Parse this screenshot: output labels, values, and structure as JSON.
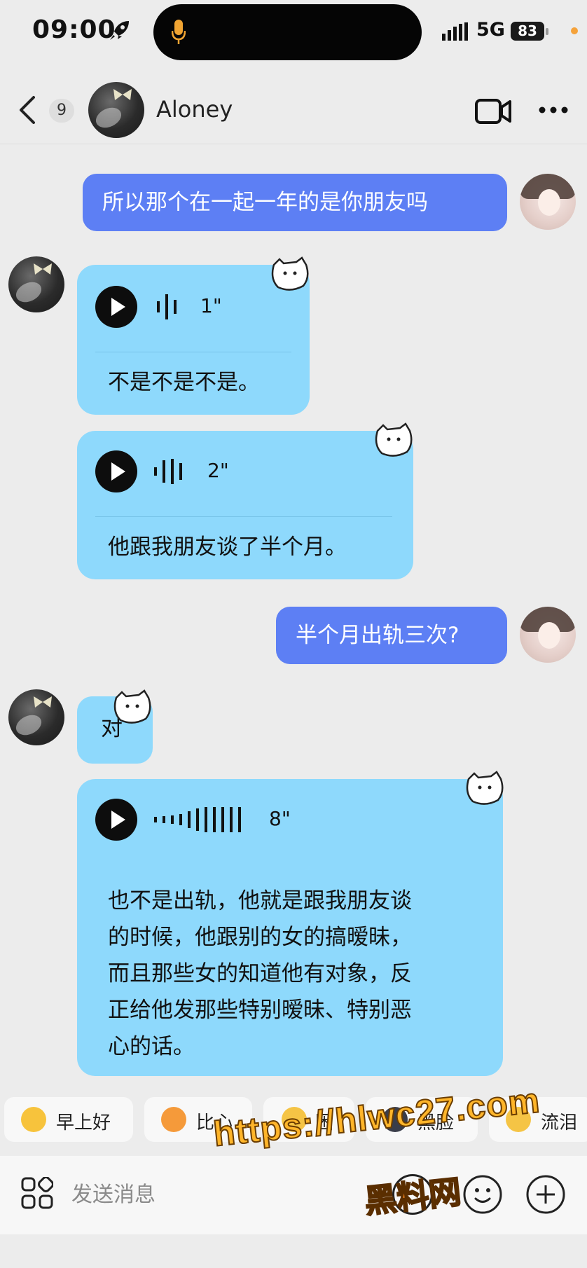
{
  "status_bar": {
    "time": "09:00",
    "network": "5G",
    "battery": "83"
  },
  "header": {
    "unread_count": "9",
    "contact_name": "Aloney"
  },
  "messages": [
    {
      "side": "out",
      "text": "所以那个在一起一年的是你朋友吗"
    },
    {
      "side": "in",
      "type": "voice",
      "duration": "1\"",
      "transcript": "不是不是不是。"
    },
    {
      "side": "in",
      "type": "voice",
      "duration": "2\"",
      "transcript": "他跟我朋友谈了半个月。"
    },
    {
      "side": "out",
      "text": "半个月出轨三次?"
    },
    {
      "side": "in",
      "text": "对"
    },
    {
      "side": "in",
      "type": "voice",
      "duration": "8\"",
      "transcript_lines": [
        "也不是出轨，他就是跟我朋友谈",
        "的时候，他跟别的女的搞暧昧，",
        "而且那些女的知道他有对象，反",
        "正给他发那些特别暧昧、特别恶",
        "心的话。"
      ]
    }
  ],
  "quick_replies": [
    "早上好",
    "比心",
    "困",
    "黑脸",
    "流泪"
  ],
  "input": {
    "placeholder": "发送消息"
  },
  "watermark": {
    "url": "https://hlwc27.com",
    "site_name": "黑料网"
  },
  "colors": {
    "outgoing_bubble": "#5d7ff4",
    "incoming_bubble": "#8ed9fc",
    "background": "#ececec"
  }
}
